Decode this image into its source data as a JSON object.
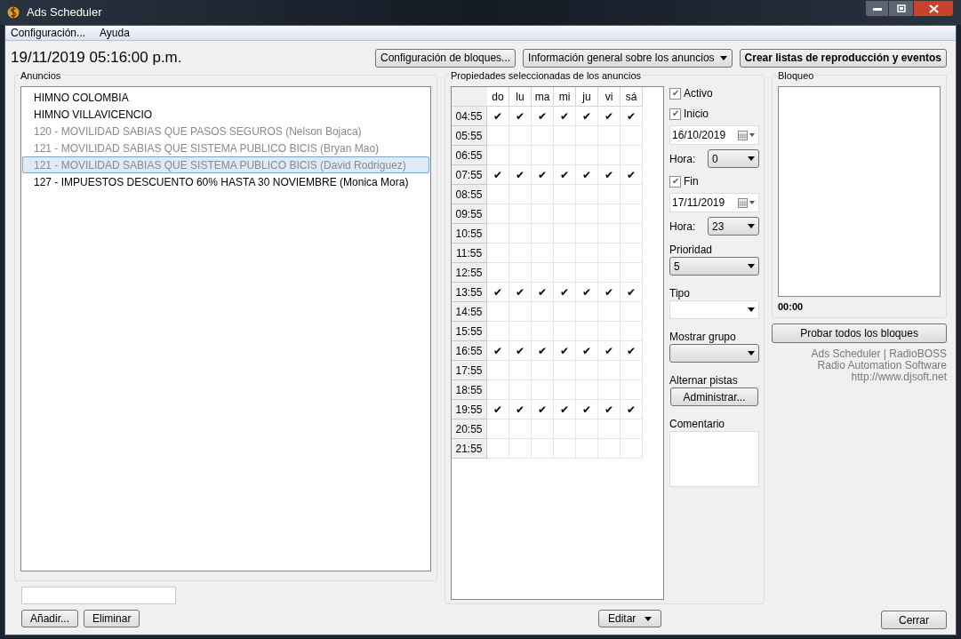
{
  "window": {
    "title": "Ads Scheduler"
  },
  "menu": [
    "Configuración...",
    "Ayuda"
  ],
  "datetime": "19/11/2019 05:16:00 p.m.",
  "toolbar": [
    {
      "label": "Configuración de bloques...",
      "dropdown": false,
      "bold": false
    },
    {
      "label": "Información general sobre los anuncios",
      "dropdown": true,
      "bold": false
    },
    {
      "label": "Crear listas de reproducción y eventos",
      "dropdown": false,
      "bold": true
    }
  ],
  "ads": {
    "title": "Anuncios",
    "items": [
      {
        "label": "HIMNO COLOMBIA",
        "disabled": false,
        "selected": false
      },
      {
        "label": "HIMNO VILLAVICENCIO",
        "disabled": false,
        "selected": false
      },
      {
        "label": "120 - MOVILIDAD SABIAS QUE PASOS SEGUROS (Nelson Bojaca)",
        "disabled": true,
        "selected": false
      },
      {
        "label": "121 - MOVILIDAD SABIAS QUE SISTEMA PUBLICO BICIS (Bryan Mao)",
        "disabled": true,
        "selected": false
      },
      {
        "label": "121 - MOVILIDAD SABIAS QUE SISTEMA PUBLICO BICIS (David Rodriguez)",
        "disabled": true,
        "selected": true
      },
      {
        "label": "127 - IMPUESTOS DESCUENTO 60% HASTA 30 NOVIEMBRE (Monica Mora)",
        "disabled": false,
        "selected": false
      }
    ],
    "buttons": [
      "Añadir...",
      "Eliminar"
    ]
  },
  "properties": {
    "title": "Propiedades seleccionadas de los anuncios",
    "days": [
      "do",
      "lu",
      "ma",
      "mi",
      "ju",
      "vi",
      "sá"
    ],
    "check_glyph": "✔",
    "rows": [
      {
        "time": "04:55",
        "days": [
          true,
          true,
          true,
          true,
          true,
          true,
          true
        ]
      },
      {
        "time": "05:55",
        "days": [
          false,
          false,
          false,
          false,
          false,
          false,
          false
        ]
      },
      {
        "time": "06:55",
        "days": [
          false,
          false,
          false,
          false,
          false,
          false,
          false
        ]
      },
      {
        "time": "07:55",
        "days": [
          true,
          true,
          true,
          true,
          true,
          true,
          true
        ]
      },
      {
        "time": "08:55",
        "days": [
          false,
          false,
          false,
          false,
          false,
          false,
          false
        ]
      },
      {
        "time": "09:55",
        "days": [
          false,
          false,
          false,
          false,
          false,
          false,
          false
        ]
      },
      {
        "time": "10:55",
        "days": [
          false,
          false,
          false,
          false,
          false,
          false,
          false
        ]
      },
      {
        "time": "11:55",
        "days": [
          false,
          false,
          false,
          false,
          false,
          false,
          false
        ]
      },
      {
        "time": "12:55",
        "days": [
          false,
          false,
          false,
          false,
          false,
          false,
          false
        ]
      },
      {
        "time": "13:55",
        "days": [
          true,
          true,
          true,
          true,
          true,
          true,
          true
        ]
      },
      {
        "time": "14:55",
        "days": [
          false,
          false,
          false,
          false,
          false,
          false,
          false
        ]
      },
      {
        "time": "15:55",
        "days": [
          false,
          false,
          false,
          false,
          false,
          false,
          false
        ]
      },
      {
        "time": "16:55",
        "days": [
          true,
          true,
          true,
          true,
          true,
          true,
          true
        ]
      },
      {
        "time": "17:55",
        "days": [
          false,
          false,
          false,
          false,
          false,
          false,
          false
        ]
      },
      {
        "time": "18:55",
        "days": [
          false,
          false,
          false,
          false,
          false,
          false,
          false
        ]
      },
      {
        "time": "19:55",
        "days": [
          true,
          true,
          true,
          true,
          true,
          true,
          true
        ]
      },
      {
        "time": "20:55",
        "days": [
          false,
          false,
          false,
          false,
          false,
          false,
          false
        ]
      },
      {
        "time": "21:55",
        "days": [
          false,
          false,
          false,
          false,
          false,
          false,
          false
        ]
      }
    ],
    "edit_button": "Editar",
    "controls": [
      {
        "kind": "checkbox",
        "label": "Activo",
        "checked": true
      },
      {
        "kind": "checkbox",
        "label": "Inicio",
        "checked": true
      },
      {
        "kind": "date",
        "value": "16/10/2019"
      },
      {
        "kind": "hour",
        "label": "Hora:",
        "value": "0"
      },
      {
        "kind": "checkbox",
        "label": "Fin",
        "checked": true
      },
      {
        "kind": "date",
        "value": "17/11/2019"
      },
      {
        "kind": "hour",
        "label": "Hora:",
        "value": "23"
      },
      {
        "kind": "label",
        "label": "Prioridad"
      },
      {
        "kind": "select",
        "value": "5",
        "white": false
      },
      {
        "kind": "label",
        "label": "Tipo"
      },
      {
        "kind": "select",
        "white": true
      },
      {
        "kind": "label",
        "label": "Mostrar grupo"
      },
      {
        "kind": "select",
        "white": false
      },
      {
        "kind": "label",
        "label": "Alternar pistas"
      },
      {
        "kind": "button",
        "label": "Administrar..."
      },
      {
        "kind": "label",
        "label": "Comentario"
      },
      {
        "kind": "textarea"
      }
    ]
  },
  "bloqueo": {
    "title": "Bloqueo",
    "time": "00:00",
    "button": "Probar todos los bloques",
    "credits": [
      "Ads Scheduler | RadioBOSS",
      "Radio Automation Software",
      "http://www.djsoft.net"
    ]
  },
  "close_button": "Cerrar"
}
